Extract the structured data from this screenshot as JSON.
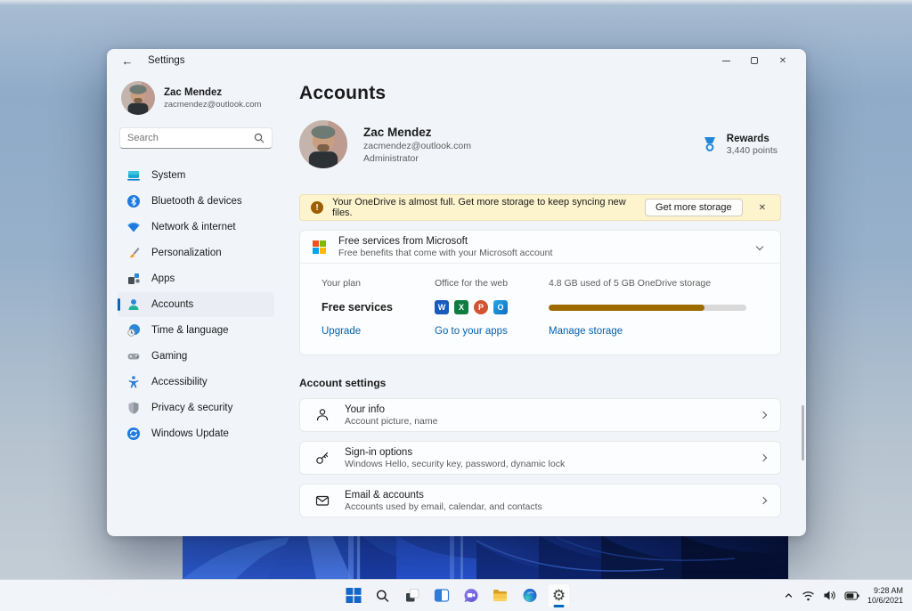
{
  "window": {
    "title": "Settings"
  },
  "sidebar": {
    "user": {
      "name": "Zac Mendez",
      "email": "zacmendez@outlook.com"
    },
    "search_placeholder": "Search",
    "items": [
      {
        "label": "System",
        "selected": false
      },
      {
        "label": "Bluetooth & devices",
        "selected": false
      },
      {
        "label": "Network & internet",
        "selected": false
      },
      {
        "label": "Personalization",
        "selected": false
      },
      {
        "label": "Apps",
        "selected": false
      },
      {
        "label": "Accounts",
        "selected": true
      },
      {
        "label": "Time & language",
        "selected": false
      },
      {
        "label": "Gaming",
        "selected": false
      },
      {
        "label": "Accessibility",
        "selected": false
      },
      {
        "label": "Privacy & security",
        "selected": false
      },
      {
        "label": "Windows Update",
        "selected": false
      }
    ]
  },
  "main": {
    "title": "Accounts",
    "profile": {
      "name": "Zac Mendez",
      "email": "zacmendez@outlook.com",
      "role": "Administrator"
    },
    "rewards": {
      "label": "Rewards",
      "points": "3,440 points"
    },
    "banner": {
      "text": "Your OneDrive is almost full. Get more storage to keep syncing new files.",
      "button_label": "Get more storage"
    },
    "expander": {
      "title": "Free services from Microsoft",
      "subtitle": "Free benefits that come with your Microsoft account"
    },
    "plan": {
      "label": "Your plan",
      "value": "Free services",
      "link": "Upgrade"
    },
    "office": {
      "label": "Office for the web",
      "link": "Go to your apps",
      "apps": [
        "W",
        "X",
        "P",
        "O"
      ]
    },
    "storage": {
      "label": "4.8 GB used of 5 GB OneDrive storage",
      "link": "Manage storage",
      "percent_used": 79
    },
    "section_title": "Account settings",
    "settings": [
      {
        "title": "Your info",
        "subtitle": "Account picture, name"
      },
      {
        "title": "Sign-in options",
        "subtitle": "Windows Hello, security key, password, dynamic lock"
      },
      {
        "title": "Email & accounts",
        "subtitle": "Accounts used by email, calendar, and contacts"
      }
    ]
  },
  "taskbar": {
    "icons": [
      "start",
      "search",
      "task-view",
      "widgets",
      "chat",
      "file-explorer",
      "edge",
      "settings"
    ],
    "active_icon": "settings",
    "tray": {
      "time": "9:28 AM",
      "date": "10/6/2021"
    }
  },
  "icons": {
    "back_arrow": "←",
    "close": "✕",
    "warning": "!",
    "gear": "⚙"
  },
  "colors": {
    "accent": "#0067c4",
    "link": "#0062b1",
    "banner_bg": "#fdf3cd",
    "warning": "#9d5d00",
    "progress_fill": "#9d6b00"
  }
}
